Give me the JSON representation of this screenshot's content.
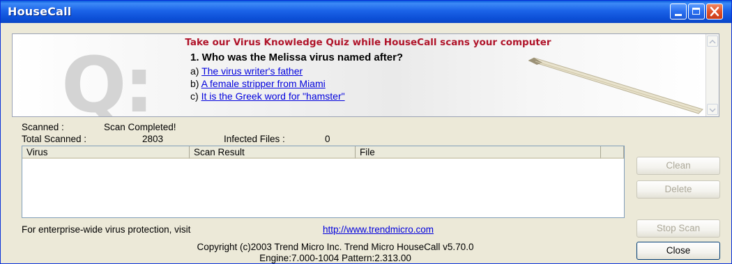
{
  "window": {
    "title": "HouseCall"
  },
  "quiz": {
    "heading": "Take our Virus Knowledge Quiz while HouseCall scans your computer",
    "badge": "Q:",
    "question": "1. Who was the Melissa virus named after?",
    "answers": [
      {
        "prefix": "a)",
        "text": "The virus writer's father"
      },
      {
        "prefix": "b)",
        "text": "A female stripper from Miami"
      },
      {
        "prefix": "c)",
        "text": "It is the Greek word for \"hamster\""
      }
    ]
  },
  "scan": {
    "scanned_label": "Scanned :",
    "scanned_value": "Scan Completed!",
    "total_label": "Total Scanned :",
    "total_value": "2803",
    "infected_label": "Infected Files :",
    "infected_value": "0"
  },
  "results": {
    "columns": [
      "Virus",
      "Scan Result",
      "File",
      ""
    ],
    "rows": []
  },
  "buttons": {
    "clean": "Clean",
    "delete": "Delete",
    "stop_scan": "Stop Scan",
    "close": "Close"
  },
  "footer": {
    "visit_text": "For enterprise-wide virus protection, visit",
    "visit_link": "http://www.trendmicro.com",
    "copyright_line1": "Copyright (c)2003 Trend Micro Inc. Trend Micro HouseCall v5.70.0",
    "copyright_line2": "Engine:7.000-1004 Pattern:2.313.00"
  },
  "colors": {
    "title_bar": "#0a5ddc",
    "quiz_heading": "#b0142a",
    "link": "#0000dd",
    "window_bg": "#ece9d8"
  }
}
